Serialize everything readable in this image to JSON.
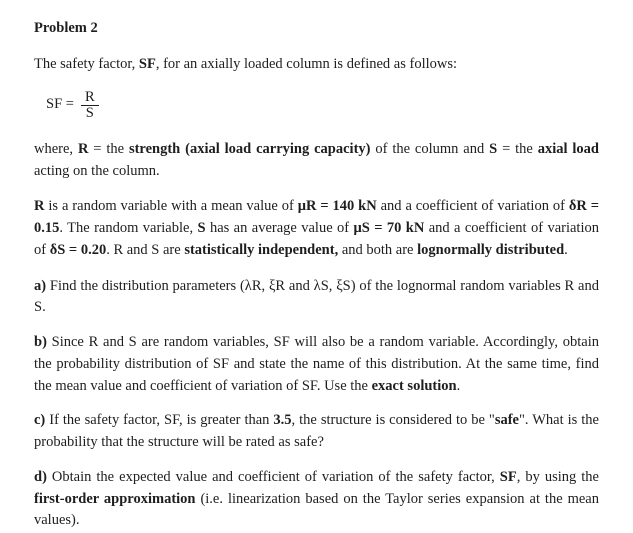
{
  "title": "Problem 2",
  "intro_1": "The safety factor, ",
  "intro_sf": "SF",
  "intro_2": ", for an axially loaded column is defined as follows:",
  "formula": {
    "lhs": "SF =",
    "num": "R",
    "den": "S"
  },
  "where_1": "where, ",
  "where_R": "R",
  "where_2": " = the ",
  "where_bold1": "strength (axial load carrying capacity)",
  "where_3": " of the column and ",
  "where_S": "S",
  "where_4": " = the ",
  "where_bold2": "axial load",
  "where_5": " acting on the column.",
  "param_1": "R",
  "param_2": " is a random variable with a mean value of ",
  "param_bold1": "μR = 140 kN",
  "param_3": " and a coefficient of variation of ",
  "param_bold2": "δR = 0.15",
  "param_4": ". The random variable, ",
  "param_bold3": "S",
  "param_5": " has an average value of ",
  "param_bold4": "μS = 70 kN",
  "param_6": " and a coefficient of variation of ",
  "param_bold5": "δS = 0.20",
  "param_7": ". R and S are ",
  "param_bold6": "statistically independent,",
  "param_8": " and both are ",
  "param_bold7": "lognormally distributed",
  "param_9": ".",
  "a_label": "a) ",
  "a_text": "Find the distribution parameters (λR, ξR and λS, ξS) of the lognormal random variables R and S.",
  "b_label": "b) ",
  "b_1": "Since R and S are random variables, SF will also be a random variable. Accordingly, obtain the probability distribution of SF and state the name of this distribution. At the same time, find the mean value and coefficient of variation of SF. Use the ",
  "b_bold": "exact solution",
  "b_2": ".",
  "c_label": "c) ",
  "c_1": "If the safety factor, SF, is greater than ",
  "c_bold1": "3.5",
  "c_2": ", the structure is considered to be \"",
  "c_bold2": "safe",
  "c_3": "\". What is the probability that the structure will be rated as safe?",
  "d_label": "d) ",
  "d_1": "Obtain the expected value and coefficient of variation of the safety factor, ",
  "d_bold1": "SF",
  "d_2": ", by using the ",
  "d_bold2": "first-order approximation",
  "d_3": " (i.e. linearization based on the Taylor series expansion at the mean values)."
}
